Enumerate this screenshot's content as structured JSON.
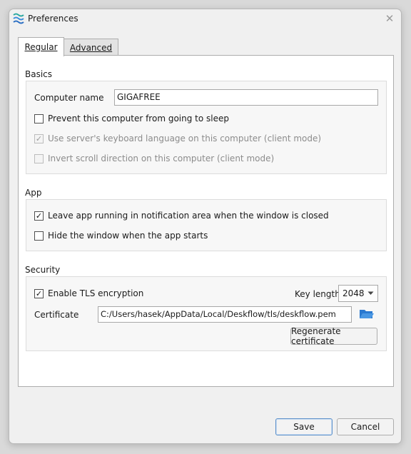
{
  "window": {
    "title": "Preferences"
  },
  "tabs": [
    {
      "label": "Regular",
      "selected": true
    },
    {
      "label": "Advanced",
      "selected": false
    }
  ],
  "basics": {
    "label": "Basics",
    "computer_name_label": "Computer name",
    "computer_name_value": "GIGAFREE",
    "prevent_sleep": {
      "label": "Prevent this computer from going to sleep",
      "checked": false,
      "enabled": true
    },
    "server_keyboard": {
      "label": "Use server's keyboard language on this computer (client mode)",
      "checked": true,
      "enabled": false
    },
    "invert_scroll": {
      "label": "Invert scroll direction on this computer (client mode)",
      "checked": false,
      "enabled": false
    }
  },
  "app": {
    "label": "App",
    "leave_running": {
      "label": "Leave app running in notification area when the window is closed",
      "checked": true,
      "enabled": true
    },
    "hide_window": {
      "label": "Hide the window when the app starts",
      "checked": false,
      "enabled": true
    }
  },
  "security": {
    "label": "Security",
    "enable_tls": {
      "label": "Enable TLS encryption",
      "checked": true,
      "enabled": true
    },
    "key_length_label": "Key length",
    "key_length_value": "2048",
    "certificate_label": "Certificate",
    "certificate_path": "C:/Users/hasek/AppData/Local/Deskflow/tls/deskflow.pem",
    "regenerate_label": "Regenerate certificate"
  },
  "footer": {
    "save_label": "Save",
    "cancel_label": "Cancel"
  },
  "colors": {
    "accent": "#2b79d0",
    "icon_blue": "#3b8ddb",
    "logo_teal": "#2aa8a0"
  }
}
